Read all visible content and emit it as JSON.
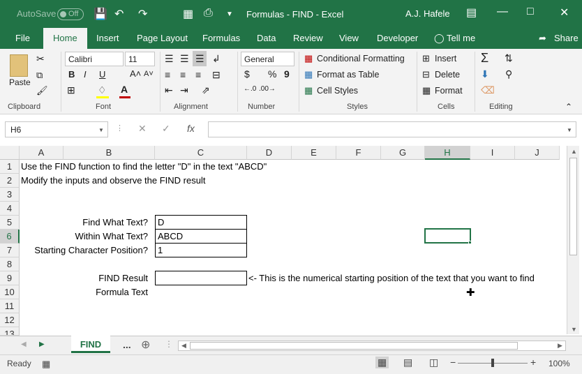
{
  "titlebar": {
    "autosave_label": "AutoSave",
    "autosave_state": "Off",
    "title": "Formulas - FIND  -  Excel",
    "user": "A.J. Hafele"
  },
  "tabs": [
    "File",
    "Home",
    "Insert",
    "Page Layout",
    "Formulas",
    "Data",
    "Review",
    "View",
    "Developer",
    "Tell me",
    "Share"
  ],
  "ribbon": {
    "clipboard": {
      "paste": "Paste",
      "label": "Clipboard"
    },
    "font": {
      "name": "Calibri",
      "size": "11",
      "bold": "B",
      "italic": "I",
      "underline": "U",
      "label": "Font"
    },
    "alignment": {
      "label": "Alignment"
    },
    "number": {
      "format": "General",
      "currency": "$",
      "percent": "%",
      "comma": "9",
      "label": "Number"
    },
    "styles": {
      "cond": "Conditional Formatting",
      "table": "Format as Table",
      "cell": "Cell Styles",
      "label": "Styles"
    },
    "cells": {
      "insert": "Insert",
      "delete": "Delete",
      "format": "Format",
      "label": "Cells"
    },
    "editing": {
      "label": "Editing"
    }
  },
  "formula_bar": {
    "namebox": "H6",
    "formula": ""
  },
  "columns": [
    "A",
    "B",
    "C",
    "D",
    "E",
    "F",
    "G",
    "H",
    "I",
    "J"
  ],
  "rows": [
    "1",
    "2",
    "3",
    "4",
    "5",
    "6",
    "7",
    "8",
    "9",
    "10",
    "11",
    "12",
    "13"
  ],
  "cells": {
    "r1": "Use the FIND function to find the letter \"D\" in the text \"ABCD\"",
    "r2": "Modify the inputs and observe the FIND result",
    "b5": "Find What Text?",
    "c5": "D",
    "b6": "Within What Text?",
    "c6": "ABCD",
    "b7": "Starting Character Position?",
    "c7": "1",
    "b9": "FIND Result",
    "c9": "",
    "d9": "<- This is the numerical starting position of the text that you want to find",
    "b10": "Formula Text"
  },
  "sheet": {
    "active": "FIND",
    "more": "..."
  },
  "status": {
    "ready": "Ready",
    "zoom": "100%"
  }
}
